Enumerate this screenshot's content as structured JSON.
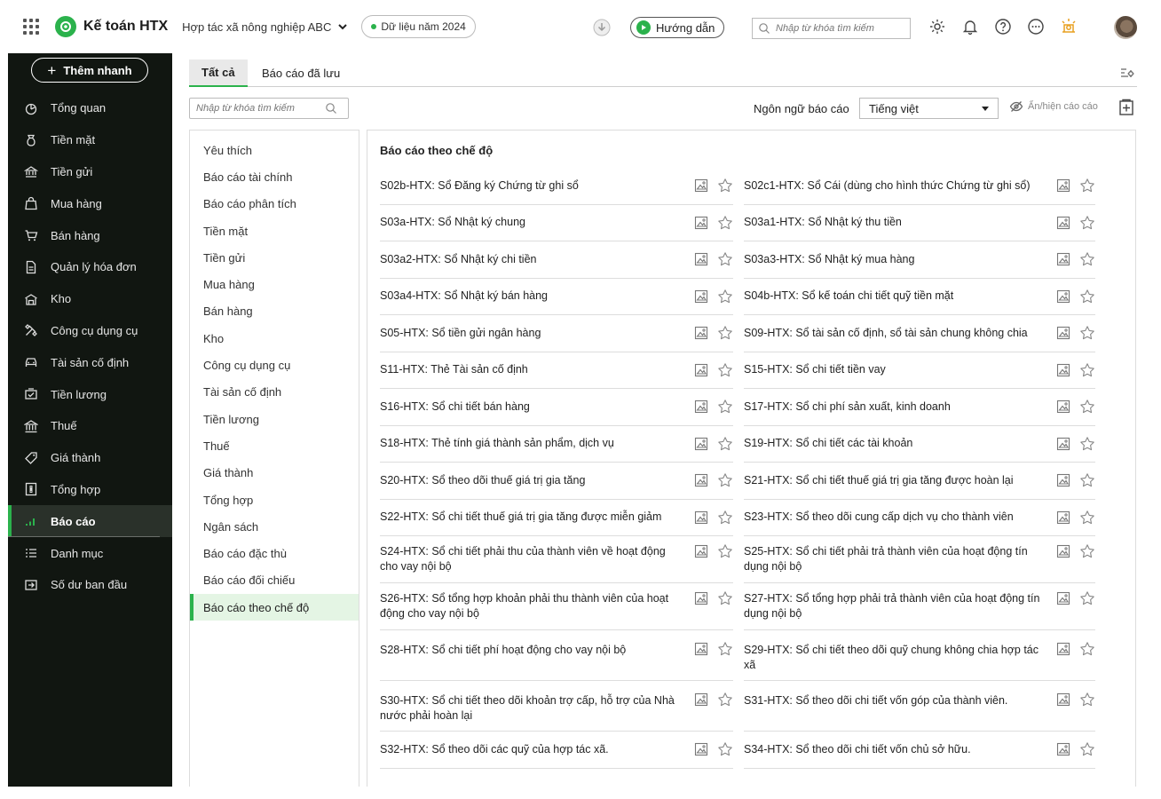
{
  "app": {
    "name": "Kế toán HTX",
    "org": "Hợp tác xã nông nghiệp ABC",
    "year": "Dữ liệu năm 2024",
    "guide": "Hướng dẫn",
    "search_placeholder": "Nhập từ khóa tìm kiếm"
  },
  "sidebar": {
    "add_label": "Thêm nhanh",
    "items": [
      {
        "label": "Tổng quan",
        "icon": "overview-icon"
      },
      {
        "label": "Tiền mặt",
        "icon": "cash-bag-icon"
      },
      {
        "label": "Tiền gửi",
        "icon": "bank-deposit-icon"
      },
      {
        "label": "Mua hàng",
        "icon": "shopping-bag-icon"
      },
      {
        "label": "Bán hàng",
        "icon": "cart-icon"
      },
      {
        "label": "Quản lý hóa đơn",
        "icon": "invoice-icon"
      },
      {
        "label": "Kho",
        "icon": "warehouse-icon"
      },
      {
        "label": "Công cụ dụng cụ",
        "icon": "tools-icon"
      },
      {
        "label": "Tài sản cố định",
        "icon": "car-icon"
      },
      {
        "label": "Tiền lương",
        "icon": "salary-icon"
      },
      {
        "label": "Thuế",
        "icon": "tax-building-icon"
      },
      {
        "label": "Giá thành",
        "icon": "price-tag-icon"
      },
      {
        "label": "Tổng hợp",
        "icon": "summary-icon"
      },
      {
        "label": "Báo cáo",
        "icon": "report-chart-icon",
        "active": true
      },
      {
        "label": "Danh mục",
        "icon": "list-icon"
      },
      {
        "label": "Số dư ban đầu",
        "icon": "opening-balance-icon"
      }
    ]
  },
  "tabs": {
    "all": "Tất cả",
    "saved": "Báo cáo đã lưu"
  },
  "filters": {
    "search_placeholder": "Nhập từ khóa tìm kiếm",
    "language_label": "Ngôn ngữ báo cáo",
    "language_value": "Tiếng việt",
    "toggle_label": "Ẩn/hiện cáo cáo"
  },
  "categories": [
    "Yêu thích",
    "Báo cáo tài chính",
    "Báo cáo phân tích",
    "Tiền mặt",
    "Tiền gửi",
    "Mua hàng",
    "Bán hàng",
    "Kho",
    "Công cụ dụng cụ",
    "Tài sản cố định",
    "Tiền lương",
    "Thuế",
    "Giá thành",
    "Tổng hợp",
    "Ngân sách",
    "Báo cáo đặc thù",
    "Báo cáo đối chiếu",
    "Báo cáo theo chế độ"
  ],
  "active_category": "Báo cáo theo chế độ",
  "panel": {
    "title": "Báo cáo theo chế độ"
  },
  "reports": [
    [
      "S02b-HTX: Sổ Đăng ký Chứng từ ghi sổ",
      "S02c1-HTX: Sổ Cái (dùng cho hình thức Chứng từ ghi sổ)"
    ],
    [
      "S03a-HTX: Sổ Nhật ký chung",
      "S03a1-HTX: Sổ Nhật ký thu tiền"
    ],
    [
      "S03a2-HTX: Sổ Nhật ký chi tiền",
      "S03a3-HTX: Sổ Nhật ký mua hàng"
    ],
    [
      "S03a4-HTX: Sổ Nhật ký bán hàng",
      "S04b-HTX: Sổ kế toán chi tiết quỹ tiền mặt"
    ],
    [
      "S05-HTX: Sổ tiền gửi ngân hàng",
      "S09-HTX: Sổ tài sản cố định, sổ tài sản chung không chia"
    ],
    [
      "S11-HTX: Thẻ Tài sản cố định",
      "S15-HTX: Sổ chi tiết tiền vay"
    ],
    [
      "S16-HTX: Sổ chi tiết bán hàng",
      "S17-HTX: Sổ chi phí sản xuất, kinh doanh"
    ],
    [
      "S18-HTX: Thẻ tính giá thành sản phẩm, dịch vụ",
      "S19-HTX: Sổ chi tiết các tài khoản"
    ],
    [
      "S20-HTX: Sổ theo dõi thuế giá trị gia tăng",
      "S21-HTX: Sổ chi tiết thuế giá trị gia tăng được hoàn lại"
    ],
    [
      "S22-HTX: Sổ chi tiết thuế giá trị gia tăng được miễn giảm",
      "S23-HTX: Sổ theo dõi cung cấp dịch vụ cho thành viên"
    ],
    [
      "S24-HTX: Sổ chi tiết phải thu của thành viên về hoạt động cho vay nội bộ",
      "S25-HTX: Sổ chi tiết phải trả thành viên của hoạt động tín dụng nội bộ"
    ],
    [
      "S26-HTX: Sổ tổng hợp khoản phải thu thành viên của hoạt động cho vay nội bộ",
      "S27-HTX: Sổ tổng hợp phải trả thành viên của hoạt động tín dụng nội bộ"
    ],
    [
      "S28-HTX: Sổ chi tiết phí hoạt động cho vay nội bộ",
      "S29-HTX: Sổ chi tiết theo dõi quỹ chung không chia hợp tác xã"
    ],
    [
      "S30-HTX: Sổ chi tiết theo dõi khoản trợ cấp, hỗ trợ của Nhà nước phải hoàn lại",
      "S31-HTX: Sổ theo dõi chi tiết vốn góp của thành viên."
    ],
    [
      "S32-HTX: Sổ theo dõi các quỹ của hợp tác xã.",
      "S34-HTX: Sổ theo dõi chi tiết vốn chủ sở hữu."
    ]
  ],
  "colors": {
    "accent": "#2bb24c",
    "sidebar_bg": "#111611",
    "active_category_bg": "#e4f5e4"
  }
}
